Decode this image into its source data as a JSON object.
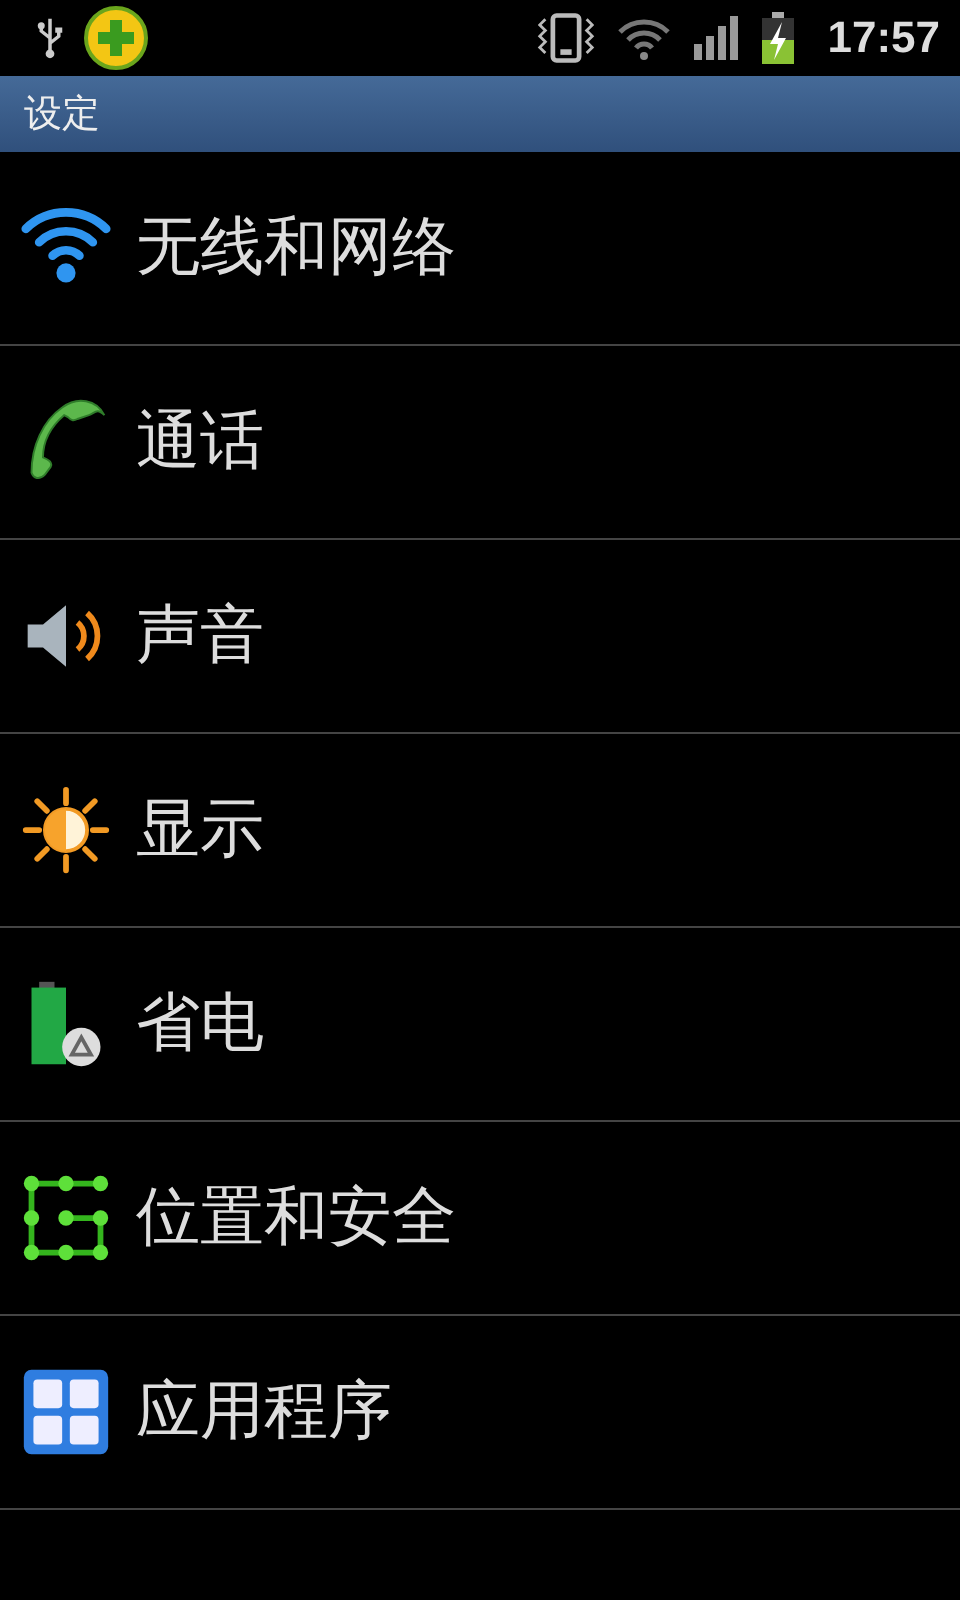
{
  "status_bar": {
    "time": "17:57"
  },
  "title_bar": {
    "title": "设定"
  },
  "settings": [
    {
      "label": "无线和网络"
    },
    {
      "label": "通话"
    },
    {
      "label": "声音"
    },
    {
      "label": "显示"
    },
    {
      "label": "省电"
    },
    {
      "label": "位置和安全"
    },
    {
      "label": "应用程序"
    }
  ]
}
